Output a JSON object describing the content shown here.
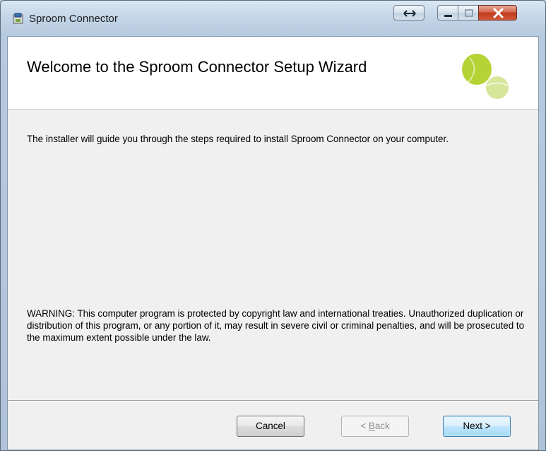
{
  "window": {
    "title": "Sproom Connector"
  },
  "banner": {
    "title": "Welcome to the Sproom Connector Setup Wizard",
    "logo_icon": "sproom-logo-icon",
    "logo_colors": [
      "#b5d334",
      "#d7e69a"
    ]
  },
  "body": {
    "intro": "The installer will guide you through the steps required to install Sproom Connector on your computer.",
    "warning": "WARNING: This computer program is protected by copyright law and international treaties. Unauthorized duplication or distribution of this program, or any portion of it, may result in severe civil or criminal penalties, and will be prosecuted to the maximum extent possible under the law."
  },
  "buttons": {
    "cancel": "Cancel",
    "back_prefix": "< ",
    "back_mnemonic": "B",
    "back_rest": "ack",
    "next": "Next >"
  }
}
